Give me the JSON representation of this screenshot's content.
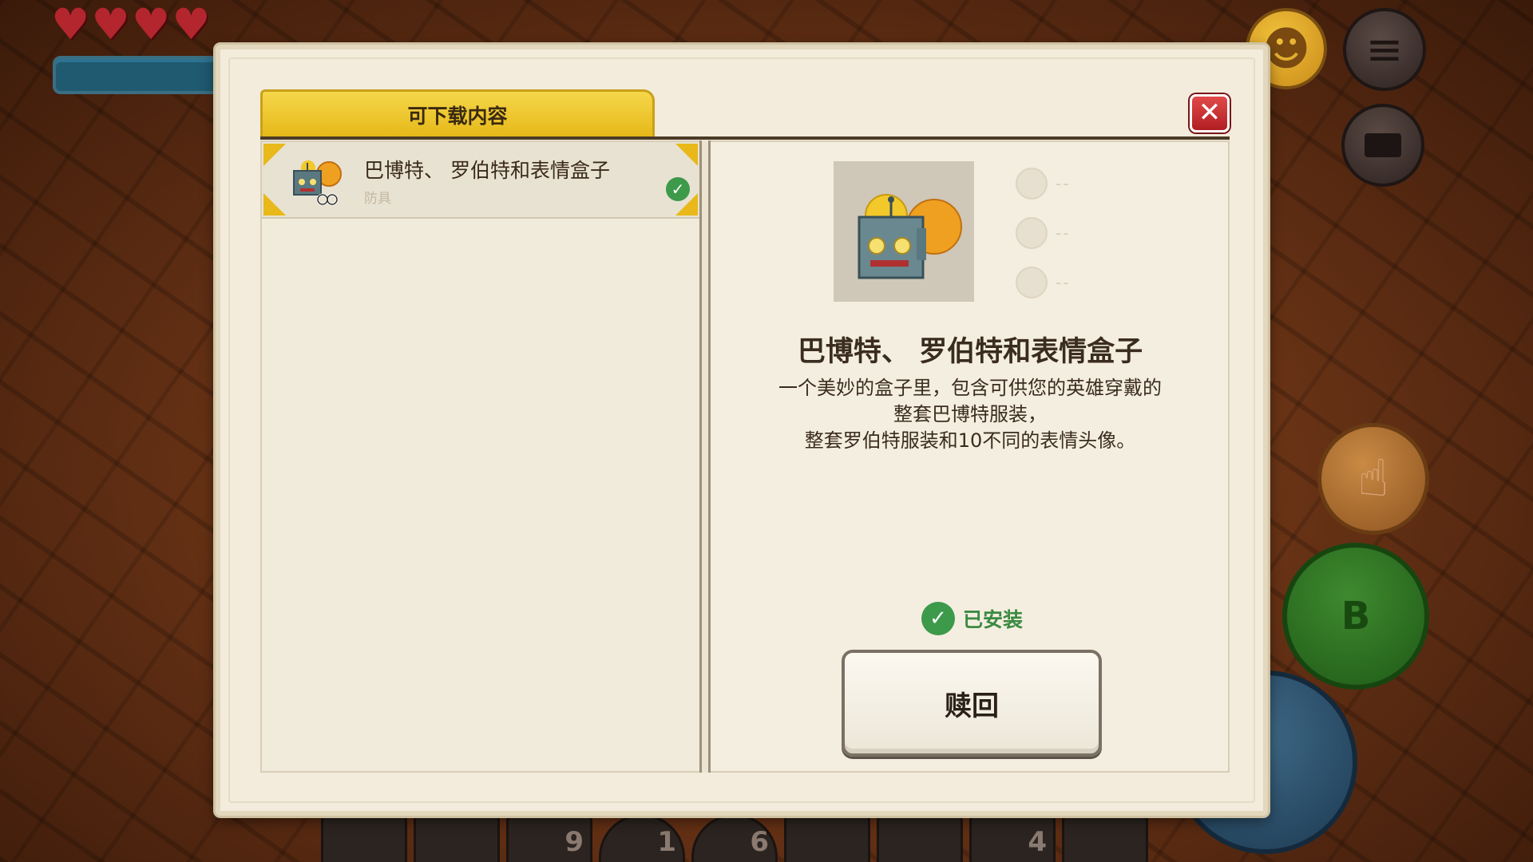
{
  "hud": {
    "hearts": [
      "♥",
      "♥",
      "♥",
      "♥"
    ],
    "emoji_glyph": "☻",
    "menu_glyph": "≡",
    "hand_glyph": "☝",
    "b_button_label": "B",
    "hotbar": [
      "",
      "",
      "9",
      "1",
      "6",
      "",
      "",
      "4",
      ""
    ]
  },
  "dialog": {
    "tab_label": "可下载内容",
    "close_glyph": "✕",
    "list": [
      {
        "name": "巴博特、 罗伯特和表情盒子",
        "category": "防具",
        "installed": true
      }
    ],
    "detail": {
      "title": "巴博特、 罗伯特和表情盒子",
      "description_lines": [
        "一个美妙的盒子里，包含可供您的英雄穿戴的",
        "整套巴博特服装，",
        "整套罗伯特服装和10不同的表情头像。"
      ],
      "variant_placeholders": [
        "--",
        "--",
        "--"
      ],
      "installed_label": "已安装",
      "redeem_label": "赎回"
    }
  },
  "colors": {
    "tab_yellow": "#e6b818",
    "installed_green": "#3c9a4a",
    "close_red": "#b01e22"
  }
}
